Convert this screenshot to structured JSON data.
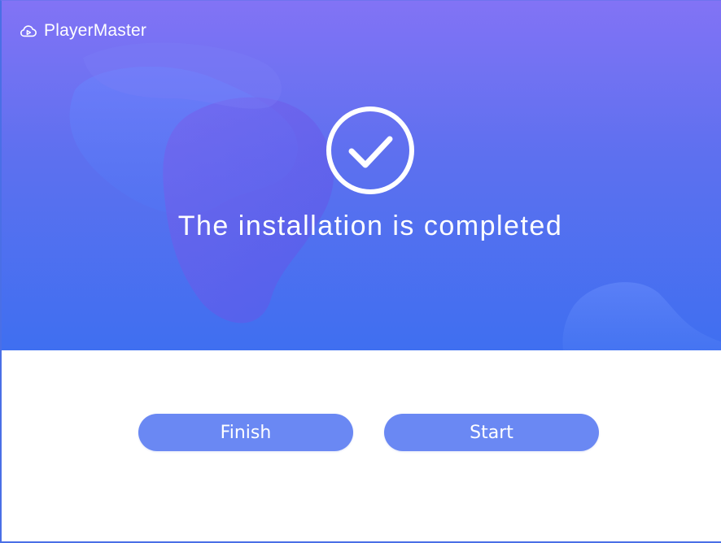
{
  "window": {
    "app_title": "PlayerMaster",
    "logo_icon": "cloud-play-icon"
  },
  "status": {
    "icon": "check-circle-icon",
    "message": "The installation is completed"
  },
  "actions": {
    "finish_label": "Finish",
    "start_label": "Start"
  },
  "colors": {
    "gradient_top": "#8273f5",
    "gradient_bottom": "#3f6ff0",
    "button": "#6a88f3",
    "text_on_accent": "#ffffff"
  }
}
